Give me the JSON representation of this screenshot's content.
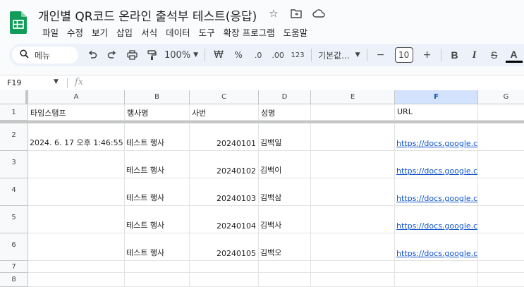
{
  "app": {
    "title": "개인별 QR코드 온라인 출석부 테스트(응답)",
    "brand_color": "#0f9d58"
  },
  "menu": [
    "파일",
    "수정",
    "보기",
    "삽입",
    "서식",
    "데이터",
    "도구",
    "확장 프로그램",
    "도움말"
  ],
  "title_icons": [
    "star-icon",
    "move-to-folder-icon",
    "cloud-status-icon"
  ],
  "toolbar": {
    "search_label": "메뉴",
    "zoom": "100%",
    "currency": "₩",
    "percent": "%",
    "dec_decrease": ".0",
    "dec_increase": ".00",
    "number_format": "123",
    "font": "기본값...",
    "font_size_minus": "−",
    "font_size": "10",
    "font_size_plus": "+",
    "bold": "B",
    "italic": "I",
    "strike": "S"
  },
  "formula_bar": {
    "cell_ref": "F19",
    "fx": "fx",
    "value": ""
  },
  "columns": [
    "A",
    "B",
    "C",
    "D",
    "E",
    "F",
    "G"
  ],
  "selected_column": "F",
  "row_numbers": [
    "1",
    "2",
    "3",
    "4",
    "5",
    "6",
    "7",
    "8"
  ],
  "header_row": [
    "타임스탬프",
    "행사명",
    "사번",
    "성명",
    "",
    "URL"
  ],
  "rows": [
    [
      "2024. 6. 17 오후 1:46:55",
      "테스트 행사",
      "20240101",
      "김백일",
      "",
      "https://docs.google.com/forms/d/e"
    ],
    [
      "",
      "테스트 행사",
      "20240102",
      "김백이",
      "",
      "https://docs.google.com/forms/d/e"
    ],
    [
      "",
      "테스트 행사",
      "20240103",
      "김백삼",
      "",
      "https://docs.google.com/forms/d/e"
    ],
    [
      "",
      "테스트 행사",
      "20240104",
      "김백사",
      "",
      "https://docs.google.com/forms/d/e"
    ],
    [
      "",
      "테스트 행사",
      "20240105",
      "김백오",
      "",
      "https://docs.google.com/forms/d/e"
    ]
  ]
}
